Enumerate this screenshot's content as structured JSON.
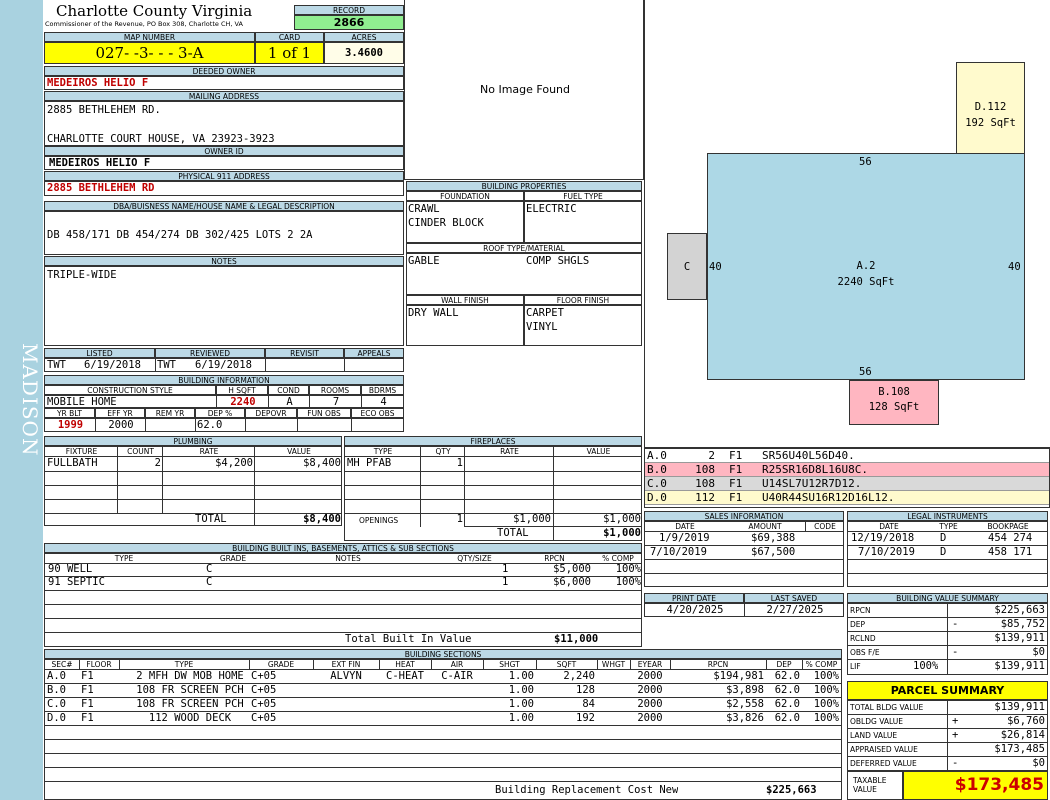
{
  "side_label": "MADISON",
  "county": {
    "name": "Charlotte County Virginia",
    "subtitle": "Commissioner of the Revenue, PO Box 308, Charlotte CH, VA"
  },
  "record": {
    "label": "RECORD",
    "value": "2866"
  },
  "map": {
    "label": "MAP NUMBER",
    "value": "027- -3- - - 3-A"
  },
  "card": {
    "label": "CARD",
    "value": "1 of 1"
  },
  "acres": {
    "label": "ACRES",
    "value": "3.4600"
  },
  "deeded_owner": {
    "label": "DEEDED OWNER",
    "value": "MEDEIROS HELIO F"
  },
  "mailing": {
    "label": "MAILING ADDRESS",
    "line1": "2885 BETHLEHEM RD.",
    "line2": "CHARLOTTE COURT HOUSE, VA 23923-3923"
  },
  "owner_id": {
    "label": "OWNER ID",
    "value": "MEDEIROS HELIO F"
  },
  "physical": {
    "label": "PHYSICAL 911 ADDRESS",
    "value": "2885 BETHLEHEM RD"
  },
  "legal": {
    "label": "DBA/BUISNESS NAME/HOUSE NAME & LEGAL DESCRIPTION",
    "value": "DB 458/171 DB 454/274 DB 302/425 LOTS 2 2A"
  },
  "notes": {
    "label": "NOTES",
    "value": "TRIPLE-WIDE"
  },
  "image": {
    "text": "No Image Found"
  },
  "listing": {
    "listed_label": "LISTED",
    "reviewed_label": "REVIEWED",
    "revisit_label": "REVISIT",
    "appeals_label": "APPEALS",
    "listed_by": "TWT",
    "listed_date": "6/19/2018",
    "reviewed_by": "TWT",
    "reviewed_date": "6/19/2018"
  },
  "building_info": {
    "label": "BUILDING INFORMATION",
    "style_label": "CONSTRUCTION STYLE",
    "hsqft_label": "H SQFT",
    "cond_label": "COND",
    "rooms_label": "ROOMS",
    "bdrms_label": "BDRMS",
    "style": "MOBILE HOME",
    "hsqft": "2240",
    "cond": "A",
    "rooms": "7",
    "bdrms": "4",
    "yrblt_label": "YR BLT",
    "effyr_label": "EFF YR",
    "remyr_label": "REM YR",
    "dep_label": "DEP %",
    "depovr_label": "DEPOVR",
    "funobs_label": "FUN OBS",
    "ecoobs_label": "ECO OBS",
    "yrblt": "1999",
    "effyr": "2000",
    "dep": "62.0"
  },
  "building_props": {
    "label": "BUILDING PROPERTIES",
    "foundation_label": "FOUNDATION",
    "fuel_label": "FUEL TYPE",
    "foundation1": "CRAWL",
    "foundation2": "CINDER BLOCK",
    "fuel": "ELECTRIC",
    "roof_label": "ROOF TYPE/MATERIAL",
    "roof_type": "GABLE",
    "roof_mat": "COMP SHGLS",
    "wall_label": "WALL FINISH",
    "floor_label": "FLOOR FINISH",
    "wall": "DRY WALL",
    "floor1": "CARPET",
    "floor2": "VINYL"
  },
  "sketch": {
    "d_label": "D.112",
    "d_area": "192 SqFt",
    "a_label": "A.2",
    "a_area": "2240 SqFt",
    "c_label": "C",
    "b_label": "B.108",
    "b_area": "128 SqFt",
    "top": "56",
    "bottom": "56",
    "left": "40",
    "right": "40"
  },
  "sketch_list": [
    {
      "id": "A.0",
      "a": "2",
      "f": "F1",
      "code": "SR56U40L56D40.",
      "color": "#ffffff"
    },
    {
      "id": "B.0",
      "a": "108",
      "f": "F1",
      "code": "R25SR16D8L16U8C.",
      "color": "#ffb6c1"
    },
    {
      "id": "C.0",
      "a": "108",
      "f": "F1",
      "code": "U14SL7U12R7D12.",
      "color": "#d9d9d9"
    },
    {
      "id": "D.0",
      "a": "112",
      "f": "F1",
      "code": "U40R44SU16R12D16L12.",
      "color": "#fffacd"
    }
  ],
  "plumbing": {
    "label": "PLUMBING",
    "h": [
      "FIXTURE",
      "COUNT",
      "RATE",
      "VALUE"
    ],
    "rows": [
      [
        "FULLBATH",
        "2",
        "$4,200",
        "$8,400"
      ]
    ],
    "total_label": "TOTAL",
    "total": "$8,400"
  },
  "fireplaces": {
    "label": "FIREPLACES",
    "h": [
      "TYPE",
      "QTY",
      "RATE",
      "VALUE"
    ],
    "rows": [
      [
        "MH PFAB",
        "1",
        "",
        ""
      ]
    ],
    "openings_label": "OPENINGS",
    "openings_qty": "1",
    "openings_rate": "$1,000",
    "openings_value": "$1,000",
    "total_label": "TOTAL",
    "total": "$1,000"
  },
  "sales": {
    "label": "SALES INFORMATION",
    "h": [
      "DATE",
      "AMOUNT",
      "CODE"
    ],
    "rows": [
      [
        "1/9/2019",
        "$69,388",
        ""
      ],
      [
        "7/10/2019",
        "$67,500",
        ""
      ]
    ]
  },
  "legal_inst": {
    "label": "LEGAL INSTRUMENTS",
    "h": [
      "DATE",
      "TYPE",
      "BOOKPAGE"
    ],
    "rows": [
      [
        "12/19/2018",
        "D",
        "454 274"
      ],
      [
        "7/10/2019",
        "D",
        "458 171"
      ]
    ]
  },
  "builtins": {
    "label": "BUILDING BUILT INS, BASEMENTS, ATTICS & SUB SECTIONS",
    "h": [
      "TYPE",
      "GRADE",
      "NOTES",
      "QTY/SIZE",
      "RPCN",
      "% COMP"
    ],
    "rows": [
      [
        "90 WELL",
        "C",
        "",
        "1",
        "$5,000",
        "100%"
      ],
      [
        "91 SEPTIC",
        "C",
        "",
        "1",
        "$6,000",
        "100%"
      ]
    ],
    "total_label": "Total Built In Value",
    "total": "$11,000"
  },
  "print": {
    "print_label": "PRINT DATE",
    "saved_label": "LAST SAVED",
    "print_date": "4/20/2025",
    "saved_date": "2/27/2025"
  },
  "bvs": {
    "label": "BUILDING VALUE SUMMARY",
    "rows": [
      {
        "l": "RPCN",
        "s": "",
        "v": "$225,663"
      },
      {
        "l": "DEP",
        "s": "-",
        "v": "$85,752"
      },
      {
        "l": "RCLND",
        "s": "",
        "v": "$139,911"
      },
      {
        "l": "OBS F/E",
        "s": "-",
        "v": "$0"
      },
      {
        "l": "LIF",
        "p": "100%",
        "s": "",
        "v": "$139,911"
      }
    ]
  },
  "parcel": {
    "label": "PARCEL SUMMARY",
    "rows": [
      {
        "l": "TOTAL BLDG VALUE",
        "s": "",
        "v": "$139,911"
      },
      {
        "l": "OBLDG VALUE",
        "s": "+",
        "v": "$6,760"
      },
      {
        "l": "LAND VALUE",
        "s": "+",
        "v": "$26,814"
      },
      {
        "l": "APPRAISED VALUE",
        "s": "",
        "v": "$173,485"
      },
      {
        "l": "DEFERRED VALUE",
        "s": "-",
        "v": "$0"
      }
    ],
    "taxable_label1": "TAXABLE",
    "taxable_label2": "VALUE",
    "taxable": "$173,485"
  },
  "sections": {
    "label": "BUILDING SECTIONS",
    "h": [
      "SEC#",
      "FLOOR",
      "TYPE",
      "GRADE",
      "EXT FIN",
      "HEAT",
      "AIR",
      "SHGT",
      "SQFT",
      "WHGT",
      "EYEAR",
      "RPCN",
      "DEP",
      "% COMP"
    ],
    "rows": [
      [
        "A.0",
        "F1",
        "2 MFH DW MOB HOME",
        "C+05",
        "ALVYN",
        "C-HEAT",
        "C-AIR",
        "1.00",
        "2,240",
        "",
        "2000",
        "$194,981",
        "62.0",
        "100%"
      ],
      [
        "B.0",
        "F1",
        "108 FR SCREEN PCH",
        "C+05",
        "",
        "",
        "",
        "1.00",
        "128",
        "",
        "2000",
        "$3,898",
        "62.0",
        "100%"
      ],
      [
        "C.0",
        "F1",
        "108 FR SCREEN PCH",
        "C+05",
        "",
        "",
        "",
        "1.00",
        "84",
        "",
        "2000",
        "$2,558",
        "62.0",
        "100%"
      ],
      [
        "D.0",
        "F1",
        "112 WOOD DECK",
        "C+05",
        "",
        "",
        "",
        "1.00",
        "192",
        "",
        "2000",
        "$3,826",
        "62.0",
        "100%"
      ]
    ],
    "total_label": "Building Replacement Cost New",
    "total": "$225,663"
  }
}
